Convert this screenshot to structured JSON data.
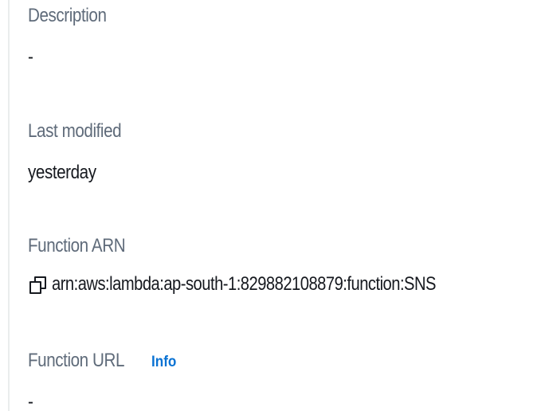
{
  "function_overview": {
    "description": {
      "label": "Description",
      "value": "-"
    },
    "last_modified": {
      "label": "Last modified",
      "value": "yesterday"
    },
    "function_arn": {
      "label": "Function ARN",
      "value": "arn:aws:lambda:ap-south-1:829882108879:function:SNS",
      "copy_icon": "copy-icon"
    },
    "function_url": {
      "label": "Function URL",
      "info_link": "Info",
      "value": "-"
    }
  }
}
